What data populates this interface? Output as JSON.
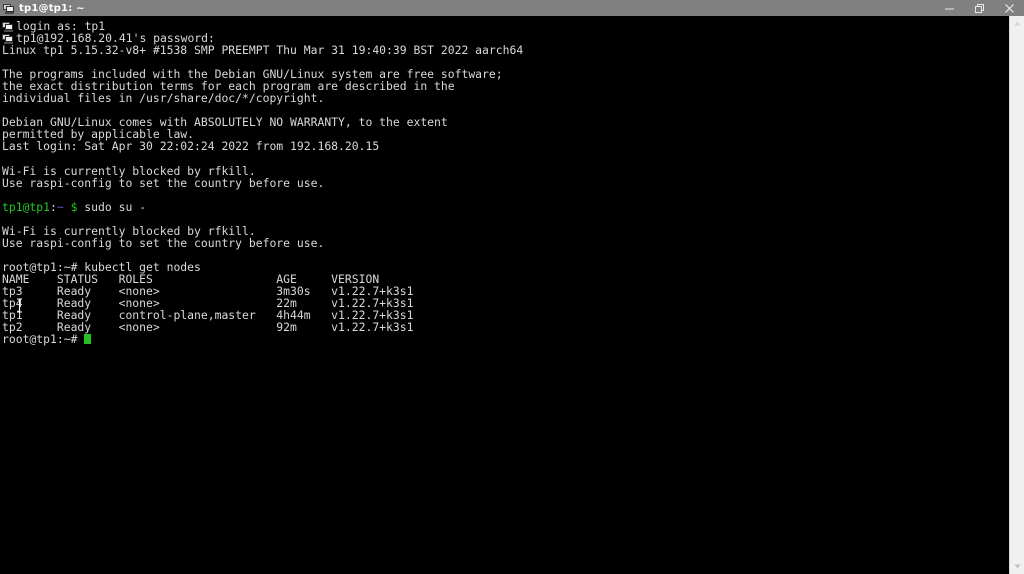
{
  "window": {
    "title": "tp1@tp1: ~",
    "icon": "putty-terminal-icon",
    "controls": {
      "minimize": "Minimize",
      "restore": "Restore",
      "close": "Close"
    },
    "titlebar_color": "#808080",
    "terminal_bg": "#000000",
    "terminal_fg": "#d9d9d9",
    "cursor_color": "#22c022"
  },
  "terminal": {
    "lines": [
      {
        "id": "login-as",
        "icon": "putty-terminal-icon",
        "text": "login as: tp1"
      },
      {
        "id": "password-prompt",
        "icon": "putty-terminal-icon",
        "text": "tp1@192.168.20.41's password:"
      },
      {
        "id": "uname",
        "text": "Linux tp1 5.15.32-v8+ #1538 SMP PREEMPT Thu Mar 31 19:40:39 BST 2022 aarch64"
      },
      {
        "id": "blank-1",
        "text": ""
      },
      {
        "id": "debian-free-1",
        "text": "The programs included with the Debian GNU/Linux system are free software;"
      },
      {
        "id": "debian-free-2",
        "text": "the exact distribution terms for each program are described in the"
      },
      {
        "id": "debian-free-3",
        "text": "individual files in /usr/share/doc/*/copyright."
      },
      {
        "id": "blank-2",
        "text": ""
      },
      {
        "id": "warranty-1",
        "text": "Debian GNU/Linux comes with ABSOLUTELY NO WARRANTY, to the extent"
      },
      {
        "id": "warranty-2",
        "text": "permitted by applicable law."
      },
      {
        "id": "last-login",
        "text": "Last login: Sat Apr 30 22:02:24 2022 from 192.168.20.15"
      },
      {
        "id": "blank-3",
        "text": ""
      },
      {
        "id": "wifi-blocked-1",
        "text": "Wi-Fi is currently blocked by rfkill."
      },
      {
        "id": "raspi-config-1",
        "text": "Use raspi-config to set the country before use."
      },
      {
        "id": "blank-4",
        "text": ""
      },
      {
        "id": "prompt-user",
        "type": "prompt-user",
        "user_host": "tp1@tp1",
        "colon": ":",
        "path": "~",
        "sigil": "$",
        "command": " sudo su -"
      },
      {
        "id": "blank-5",
        "text": ""
      },
      {
        "id": "wifi-blocked-2",
        "text": "Wi-Fi is currently blocked by rfkill."
      },
      {
        "id": "raspi-config-2",
        "text": "Use raspi-config to set the country before use."
      },
      {
        "id": "blank-6",
        "text": ""
      },
      {
        "id": "prompt-root-cmd",
        "text": "root@tp1:~# kubectl get nodes"
      },
      {
        "id": "table-header",
        "text": "NAME    STATUS   ROLES                  AGE     VERSION"
      },
      {
        "id": "row-tp3",
        "text": "tp3     Ready    <none>                 3m30s   v1.22.7+k3s1"
      },
      {
        "id": "row-tp4",
        "text": "tp4     Ready    <none>                 22m     v1.22.7+k3s1"
      },
      {
        "id": "row-tp1",
        "text": "tp1     Ready    control-plane,master   4h44m   v1.22.7+k3s1"
      },
      {
        "id": "row-tp2",
        "text": "tp2     Ready    <none>                 92m     v1.22.7+k3s1"
      },
      {
        "id": "prompt-root-end",
        "type": "prompt-root-cursor",
        "prompt": "root@tp1:~# "
      }
    ],
    "node_table": {
      "command": "kubectl get nodes",
      "columns": [
        "NAME",
        "STATUS",
        "ROLES",
        "AGE",
        "VERSION"
      ],
      "rows": [
        [
          "tp3",
          "Ready",
          "<none>",
          "3m30s",
          "v1.22.7+k3s1"
        ],
        [
          "tp4",
          "Ready",
          "<none>",
          "22m",
          "v1.22.7+k3s1"
        ],
        [
          "tp1",
          "Ready",
          "control-plane,master",
          "4h44m",
          "v1.22.7+k3s1"
        ],
        [
          "tp2",
          "Ready",
          "<none>",
          "92m",
          "v1.22.7+k3s1"
        ]
      ]
    }
  },
  "scrollbar": {
    "up_arrow": "scroll-up-arrow",
    "down_arrow": "scroll-down-arrow"
  },
  "mouse": {
    "cursor": "text-ibeam-cursor"
  }
}
